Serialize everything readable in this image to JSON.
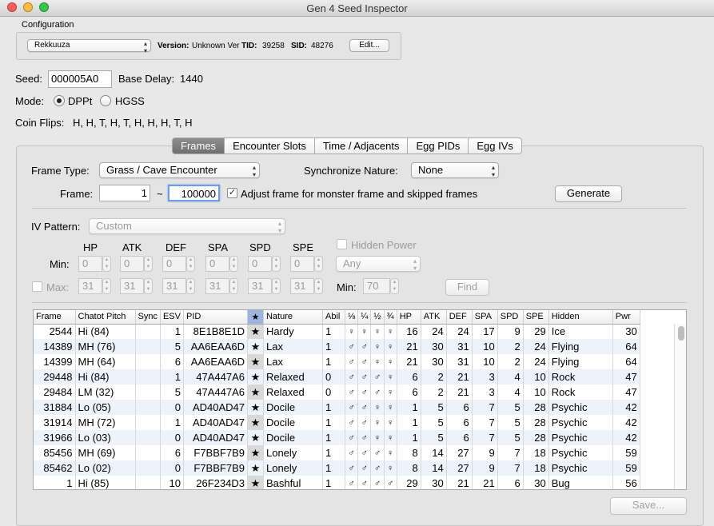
{
  "window": {
    "title": "Gen 4 Seed Inspector"
  },
  "configuration": {
    "label": "Configuration",
    "profile": "Rekkuuza",
    "version_label": "Version:",
    "version_value": "Unknown Ver",
    "tid_label": "TID:",
    "tid_value": "39258",
    "sid_label": "SID:",
    "sid_value": "48276",
    "edit_button": "Edit..."
  },
  "seed": {
    "label": "Seed:",
    "value": "000005A0",
    "base_delay_label": "Base Delay:",
    "base_delay_value": "1440"
  },
  "mode": {
    "label": "Mode:",
    "options": [
      "DPPt",
      "HGSS"
    ],
    "selected": "DPPt"
  },
  "coin_flips": {
    "label": "Coin Flips:",
    "value": "H, H, T, H, T, H, H, H, T, H"
  },
  "tabs": [
    "Frames",
    "Encounter Slots",
    "Time / Adjacents",
    "Egg PIDs",
    "Egg IVs"
  ],
  "selected_tab": "Frames",
  "frames_panel": {
    "frame_type_label": "Frame Type:",
    "frame_type_value": "Grass / Cave Encounter",
    "sync_label": "Synchronize Nature:",
    "sync_value": "None",
    "frame_label": "Frame:",
    "frame_min": "1",
    "tilde": "~",
    "frame_max": "100000",
    "adjust_label": "Adjust frame for monster frame and skipped frames",
    "adjust_checked": true,
    "generate_button": "Generate",
    "iv_pattern_label": "IV Pattern:",
    "iv_pattern_value": "Custom",
    "stat_headers": [
      "HP",
      "ATK",
      "DEF",
      "SPA",
      "SPD",
      "SPE"
    ],
    "min_label": "Min:",
    "min_values": [
      "0",
      "0",
      "0",
      "0",
      "0",
      "0"
    ],
    "max_label": "Max:",
    "max_values": [
      "31",
      "31",
      "31",
      "31",
      "31",
      "31"
    ],
    "hidden_power_label": "Hidden Power",
    "hidden_power_type": "Any",
    "hp_min_label": "Min:",
    "hp_min_value": "70",
    "find_button": "Find",
    "save_button": "Save..."
  },
  "table": {
    "columns": [
      "Frame",
      "Chatot Pitch",
      "Sync",
      "ESV",
      "PID",
      "★",
      "Nature",
      "Abil",
      "⅛",
      "¼",
      "½",
      "¾",
      "HP",
      "ATK",
      "DEF",
      "SPA",
      "SPD",
      "SPE",
      "Hidden",
      "Pwr"
    ],
    "rows": [
      [
        "2544",
        "Hi (84)",
        "",
        "1",
        "8E1B8E1D",
        "★",
        "Hardy",
        "1",
        "♀",
        "♀",
        "♀",
        "♀",
        "16",
        "24",
        "24",
        "17",
        "9",
        "29",
        "Ice",
        "30"
      ],
      [
        "14389",
        "MH (76)",
        "",
        "5",
        "AA6EAA6D",
        "★",
        "Lax",
        "1",
        "♂",
        "♂",
        "♀",
        "♀",
        "21",
        "30",
        "31",
        "10",
        "2",
        "24",
        "Flying",
        "64"
      ],
      [
        "14399",
        "MH (64)",
        "",
        "6",
        "AA6EAA6D",
        "★",
        "Lax",
        "1",
        "♂",
        "♂",
        "♀",
        "♀",
        "21",
        "30",
        "31",
        "10",
        "2",
        "24",
        "Flying",
        "64"
      ],
      [
        "29448",
        "Hi (84)",
        "",
        "1",
        "47A447A6",
        "★",
        "Relaxed",
        "0",
        "♂",
        "♂",
        "♂",
        "♀",
        "6",
        "2",
        "21",
        "3",
        "4",
        "10",
        "Rock",
        "47"
      ],
      [
        "29484",
        "LM (32)",
        "",
        "5",
        "47A447A6",
        "★",
        "Relaxed",
        "0",
        "♂",
        "♂",
        "♂",
        "♀",
        "6",
        "2",
        "21",
        "3",
        "4",
        "10",
        "Rock",
        "47"
      ],
      [
        "31884",
        "Lo (05)",
        "",
        "0",
        "AD40AD47",
        "★",
        "Docile",
        "1",
        "♂",
        "♂",
        "♀",
        "♀",
        "1",
        "5",
        "6",
        "7",
        "5",
        "28",
        "Psychic",
        "42"
      ],
      [
        "31914",
        "MH (72)",
        "",
        "1",
        "AD40AD47",
        "★",
        "Docile",
        "1",
        "♂",
        "♂",
        "♀",
        "♀",
        "1",
        "5",
        "6",
        "7",
        "5",
        "28",
        "Psychic",
        "42"
      ],
      [
        "31966",
        "Lo (03)",
        "",
        "0",
        "AD40AD47",
        "★",
        "Docile",
        "1",
        "♂",
        "♂",
        "♀",
        "♀",
        "1",
        "5",
        "6",
        "7",
        "5",
        "28",
        "Psychic",
        "42"
      ],
      [
        "85456",
        "MH (69)",
        "",
        "6",
        "F7BBF7B9",
        "★",
        "Lonely",
        "1",
        "♂",
        "♂",
        "♂",
        "♀",
        "8",
        "14",
        "27",
        "9",
        "7",
        "18",
        "Psychic",
        "59"
      ],
      [
        "85462",
        "Lo (02)",
        "",
        "0",
        "F7BBF7B9",
        "★",
        "Lonely",
        "1",
        "♂",
        "♂",
        "♂",
        "♀",
        "8",
        "14",
        "27",
        "9",
        "7",
        "18",
        "Psychic",
        "59"
      ],
      [
        "1",
        "Hi (85)",
        "",
        "10",
        "26F234D3",
        "★",
        "Bashful",
        "1",
        "♂",
        "♂",
        "♂",
        "♂",
        "29",
        "30",
        "21",
        "21",
        "6",
        "30",
        "Bug",
        "56"
      ]
    ]
  },
  "colors": {
    "selected_tab": "#7a7a7a",
    "star_header": "#9db5de",
    "row_alt": "#eef3fb"
  }
}
